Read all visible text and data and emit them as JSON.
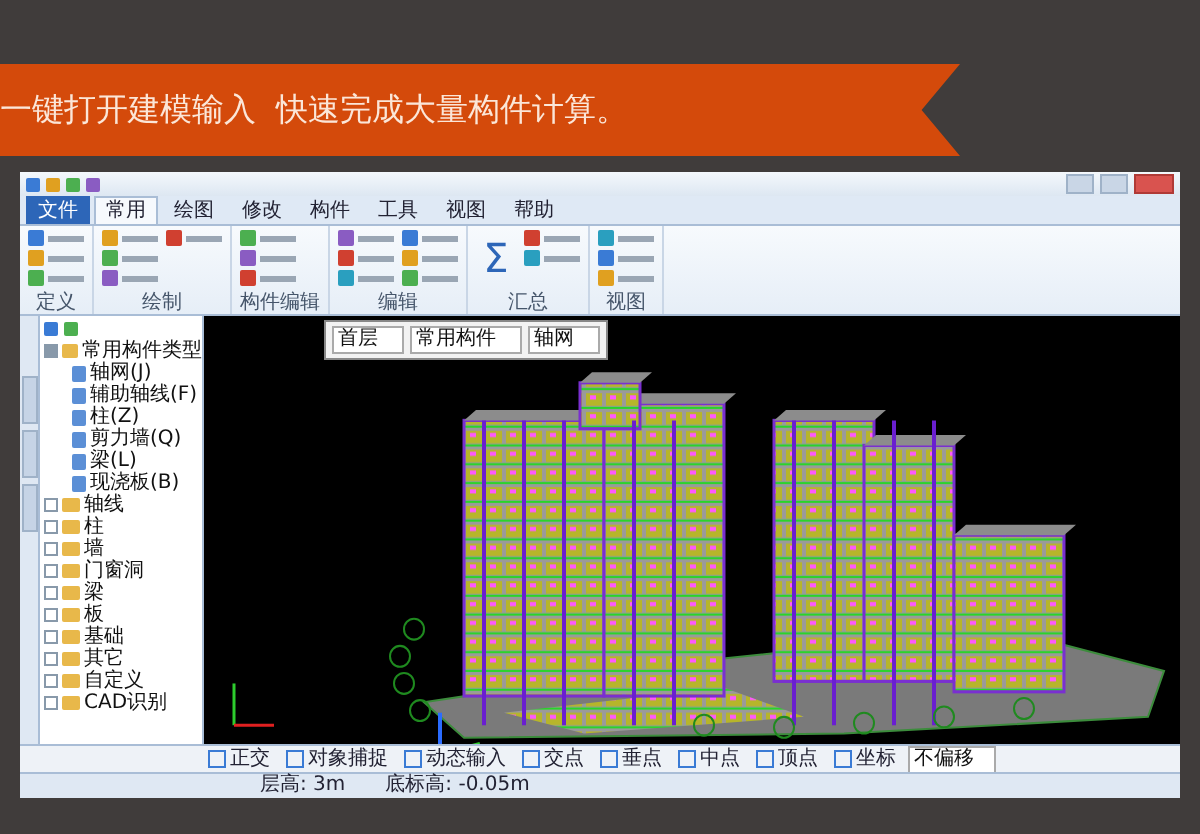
{
  "banner": {
    "text": "一键打开建模输入  快速完成大量构件计算。"
  },
  "menu_tabs": [
    {
      "label": "文件",
      "kind": "file",
      "selected": false
    },
    {
      "label": "常用",
      "kind": "tab",
      "selected": true
    },
    {
      "label": "绘图",
      "kind": "tab",
      "selected": false
    },
    {
      "label": "修改",
      "kind": "tab",
      "selected": false
    },
    {
      "label": "构件",
      "kind": "tab",
      "selected": false
    },
    {
      "label": "工具",
      "kind": "tab",
      "selected": false
    },
    {
      "label": "视图",
      "kind": "tab",
      "selected": false
    },
    {
      "label": "帮助",
      "kind": "tab",
      "selected": false
    }
  ],
  "ribbon_groups": [
    {
      "label": "定义"
    },
    {
      "label": "绘制"
    },
    {
      "label": "构件编辑"
    },
    {
      "label": "编辑"
    },
    {
      "label": "汇总",
      "icon_text": "Σ"
    },
    {
      "label": "视图"
    }
  ],
  "tree": [
    {
      "label": "常用构件类型",
      "expanded": true,
      "children": [
        {
          "label": "轴网(J)"
        },
        {
          "label": "辅助轴线(F)"
        },
        {
          "label": "柱(Z)"
        },
        {
          "label": "剪力墙(Q)"
        },
        {
          "label": "梁(L)"
        },
        {
          "label": "现浇板(B)"
        }
      ]
    },
    {
      "label": "轴线",
      "expanded": false
    },
    {
      "label": "柱",
      "expanded": false
    },
    {
      "label": "墙",
      "expanded": false
    },
    {
      "label": "门窗洞",
      "expanded": false
    },
    {
      "label": "梁",
      "expanded": false
    },
    {
      "label": "板",
      "expanded": false
    },
    {
      "label": "基础",
      "expanded": false
    },
    {
      "label": "其它",
      "expanded": false
    },
    {
      "label": "自定义",
      "expanded": false
    },
    {
      "label": "CAD识别",
      "expanded": false
    }
  ],
  "floor_selector": [
    "首层",
    "常用构件",
    "轴网"
  ],
  "snap_toolbar": [
    "正交",
    "对象捕捉",
    "动态输入",
    "交点",
    "垂点",
    "中点",
    "顶点",
    "坐标"
  ],
  "offset_mode": "不偏移",
  "status_bar": [
    "层高: 3m",
    "底标高: -0.05m"
  ]
}
